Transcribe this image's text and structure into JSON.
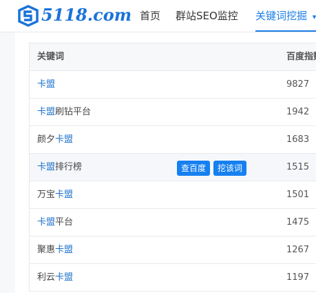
{
  "header": {
    "logo_text": "5118.com",
    "nav": [
      {
        "label": "首页"
      },
      {
        "label": "群站SEO监控"
      },
      {
        "label": "关键词挖掘"
      }
    ],
    "nav_more_glyph": "▾"
  },
  "table": {
    "columns": {
      "keyword": "关键词",
      "baidu_index": "百度指数"
    },
    "rows": [
      {
        "pre": "",
        "hl": "卡盟",
        "post": "",
        "index": "9827"
      },
      {
        "pre": "",
        "hl": "卡盟",
        "post": "刷钻平台",
        "index": "1942"
      },
      {
        "pre": "颜夕",
        "hl": "卡盟",
        "post": "",
        "index": "1683"
      },
      {
        "pre": "",
        "hl": "卡盟",
        "post": "排行榜",
        "index": "1515"
      },
      {
        "pre": "万宝",
        "hl": "卡盟",
        "post": "",
        "index": "1501"
      },
      {
        "pre": "",
        "hl": "卡盟",
        "post": "平台",
        "index": "1475"
      },
      {
        "pre": "聚惠",
        "hl": "卡盟",
        "post": "",
        "index": "1267"
      },
      {
        "pre": "利云",
        "hl": "卡盟",
        "post": "",
        "index": "1197"
      }
    ],
    "row_actions": {
      "search_baidu": "查百度",
      "mine_word": "挖该词"
    }
  },
  "colors": {
    "accent": "#1a7ee6",
    "button": "#1680f0",
    "keyword_highlight": "#1a6fc9"
  }
}
